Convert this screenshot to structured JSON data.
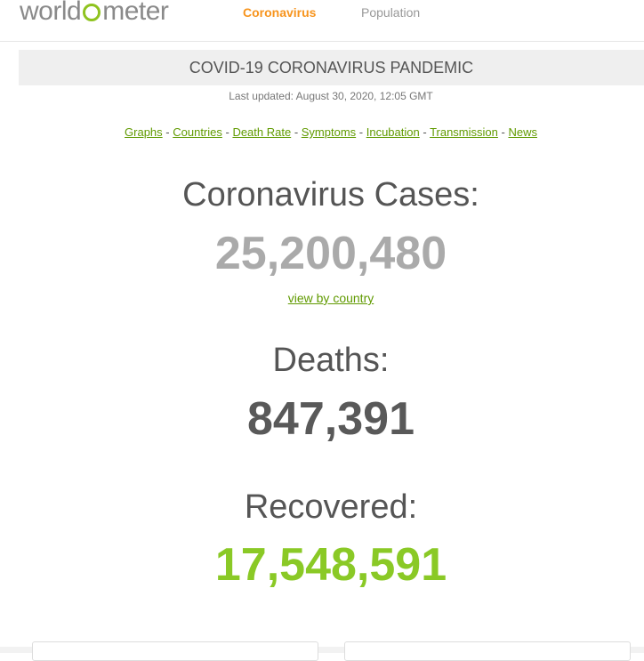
{
  "header": {
    "logo_text_before": "world",
    "logo_text_after": "meter",
    "nav": [
      {
        "label": "Coronavirus",
        "active": true
      },
      {
        "label": "Population",
        "active": false
      }
    ]
  },
  "title": "COVID-19 CORONAVIRUS PANDEMIC",
  "last_updated": "Last updated: August 30, 2020, 12:05 GMT",
  "links": [
    "Graphs",
    "Countries",
    "Death Rate",
    "Symptoms",
    "Incubation",
    "Transmission",
    "News"
  ],
  "link_separator": " - ",
  "stats": {
    "cases": {
      "label": "Coronavirus Cases:",
      "value": "25,200,480",
      "color": "#aaaaaa"
    },
    "view_by_country": "view by country",
    "deaths": {
      "label": "Deaths:",
      "value": "847,391",
      "color": "#595959"
    },
    "recovered": {
      "label": "Recovered:",
      "value": "17,548,591",
      "color": "#8ac926"
    }
  },
  "colors": {
    "brand_green": "#8fc31f",
    "link_green": "#609a00",
    "nav_active": "#f7941d"
  }
}
